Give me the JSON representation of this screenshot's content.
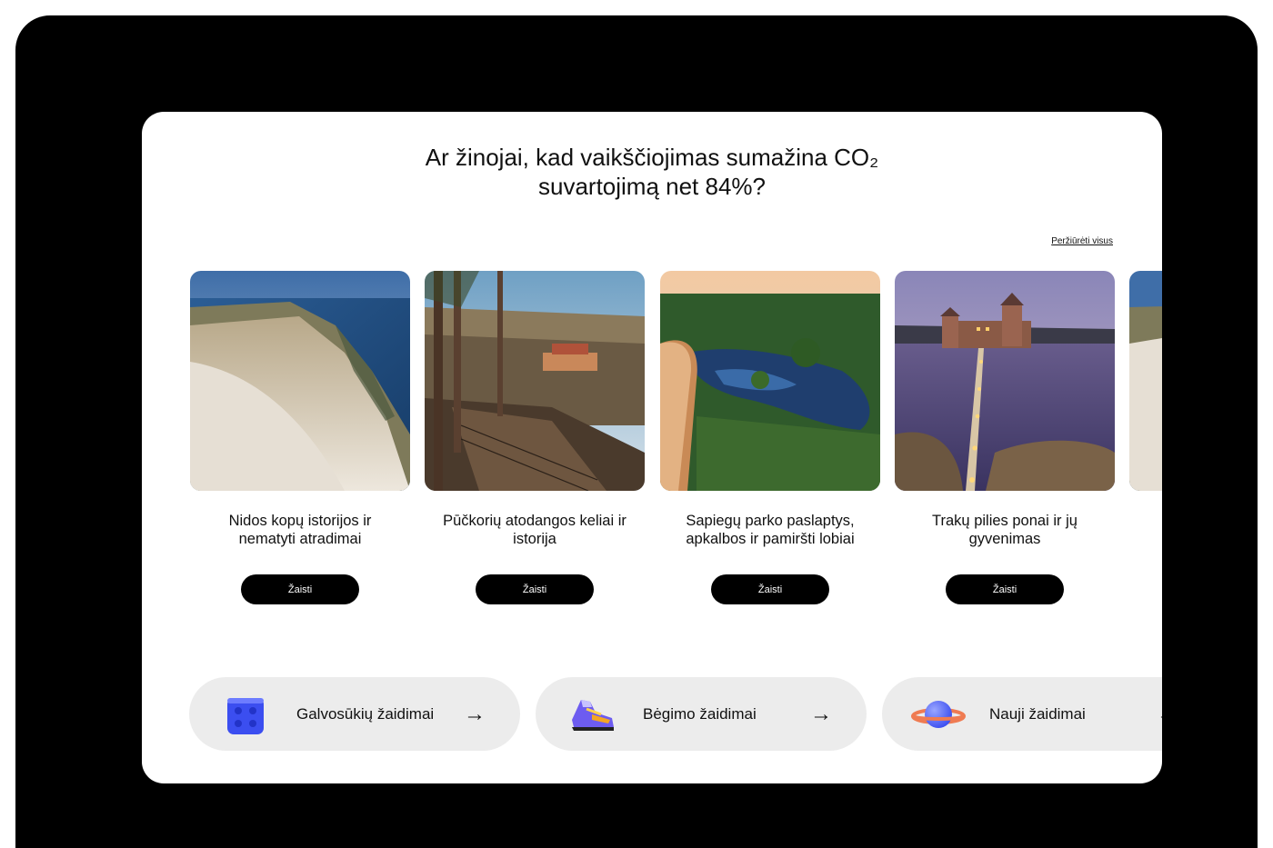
{
  "heading": {
    "line1": "Ar žinojai, kad vaikščiojimas sumažina CO₂",
    "line2": "suvartojimą net 84%?"
  },
  "view_all_label": "Peržiūrėti visus",
  "tours": [
    {
      "title": "Nidos kopų istorijos ir nematyti atradimai",
      "button": "Žaisti"
    },
    {
      "title": "Pūčkorių atodangos keliai ir istorija",
      "button": "Žaisti"
    },
    {
      "title": "Sapiegų parko paslaptys, apkalbos ir pamiršti lobiai",
      "button": "Žaisti"
    },
    {
      "title": "Trakų pilies ponai ir jų gyvenimas",
      "button": "Žaisti"
    }
  ],
  "categories": [
    {
      "label": "Galvosūkių žaidimai",
      "icon": "lego-brick-icon"
    },
    {
      "label": "Bėgimo žaidimai",
      "icon": "sneaker-icon"
    },
    {
      "label": "Nauji žaidimai",
      "icon": "planet-icon"
    }
  ],
  "arrow_glyph": "→",
  "colors": {
    "frame": "#000000",
    "card": "#ffffff",
    "pill": "#ececec",
    "accent": "#3b4ef0"
  }
}
